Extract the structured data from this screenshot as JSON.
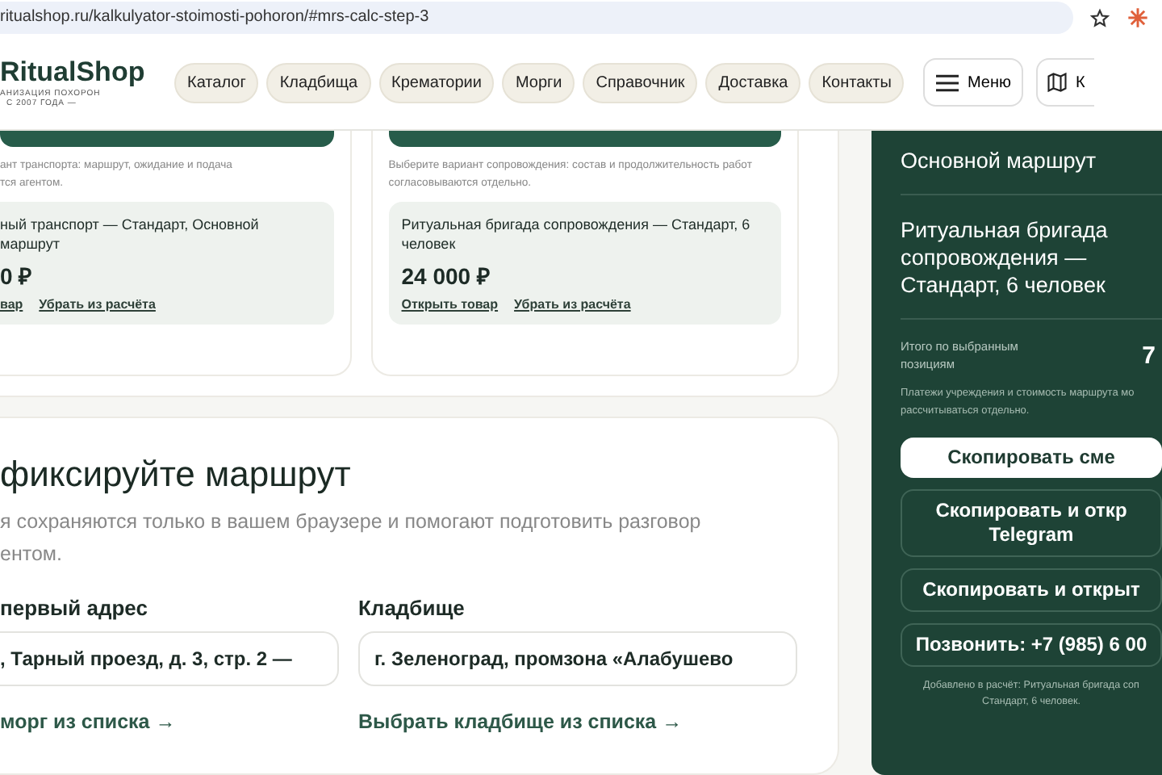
{
  "browser": {
    "url": "ritualshop.ru/kalkulyator-stoimosti-pohoron/#mrs-calc-step-3"
  },
  "header": {
    "logo": "RitualShop",
    "tagline_1": "АНИЗАЦИЯ ПОХОРОН",
    "tagline_2": "С 2007 ГОДА —",
    "nav": [
      {
        "label": "Каталог"
      },
      {
        "label": "Кладбища"
      },
      {
        "label": "Крематории"
      },
      {
        "label": "Морги"
      },
      {
        "label": "Справочник"
      },
      {
        "label": "Доставка"
      },
      {
        "label": "Контакты"
      }
    ],
    "menu_button": "Меню",
    "map_button": "К"
  },
  "service_cards": [
    {
      "description": [
        "ант транспорта: маршрут, ожидание и подача",
        "тся агентом."
      ],
      "item": "ный транспорт — Стандарт, Основной маршрут",
      "price": "0 ₽",
      "links": [
        "вар",
        "Убрать из расчёта"
      ]
    },
    {
      "description": [
        "Выберите вариант сопровождения: состав и продолжительность работ",
        "согласовываются отдельно."
      ],
      "item": "Ритуальная бригада сопровождения — Стандарт, 6 человек",
      "price": "24 000 ₽",
      "links": [
        "Открыть товар",
        "Убрать из расчёта"
      ]
    }
  ],
  "route": {
    "title": "фиксируйте маршрут",
    "description": [
      "я сохраняются только в вашем браузере и помогают подготовить разговор",
      "ентом."
    ],
    "fields": [
      {
        "label": "первый адрес",
        "value": ", Тарный проезд, д. 3, стр. 2 —",
        "link": "морг из списка →"
      },
      {
        "label": "Кладбище",
        "value": "г. Зеленоград, промзона «Алабушево",
        "link": "Выбрать кладбище из списка →"
      }
    ]
  },
  "summary": {
    "items": [
      "Основной маршрут",
      "Ритуальная бригада сопровождения — Стандарт, 6 человек"
    ],
    "total_label": "Итого по выбранным позициям",
    "total_value": "7",
    "note": "Платежи учреждения и стоимость маршрута мо рассчитываться отдельно.",
    "buttons": [
      {
        "label": "Скопировать сме",
        "kind": "primary"
      },
      {
        "label": "Скопировать и откр Telegram",
        "kind": "outline"
      },
      {
        "label": "Скопировать и открыт",
        "kind": "outline"
      },
      {
        "label": "Позвонить: +7 (985) 6 00",
        "kind": "outline"
      }
    ],
    "footnote": [
      "Добавлено в расчёт: Ритуальная бригада соп",
      "Стандарт, 6 человек."
    ]
  }
}
